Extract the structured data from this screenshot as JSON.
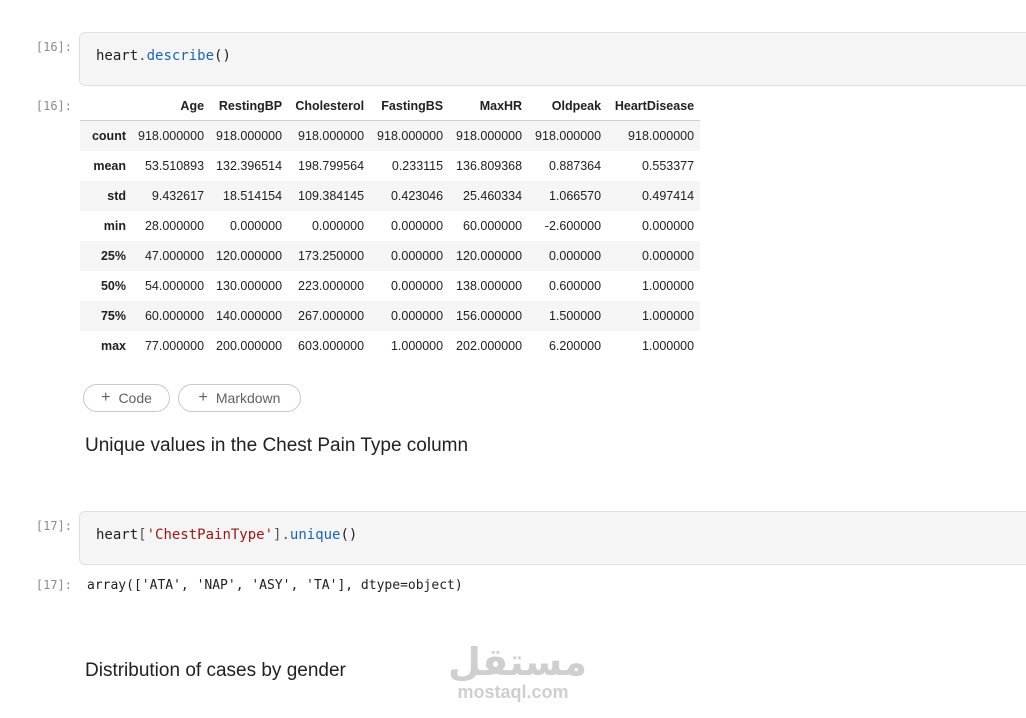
{
  "cells": {
    "describe": {
      "in_prompt": "[16]:",
      "out_prompt": "[16]:",
      "code_obj": "heart",
      "code_dot": ".",
      "code_func": "describe",
      "code_paren": "()"
    },
    "unique": {
      "in_prompt": "[17]:",
      "out_prompt": "[17]:",
      "code_obj": "heart",
      "code_lbr": "[",
      "code_str": "'ChestPainType'",
      "code_rbr": "]",
      "code_dot": ".",
      "code_func": "unique",
      "code_paren": "()",
      "output": "array(['ATA', 'NAP', 'ASY', 'TA'], dtype=object)"
    }
  },
  "table": {
    "columns": [
      "",
      "Age",
      "RestingBP",
      "Cholesterol",
      "FastingBS",
      "MaxHR",
      "Oldpeak",
      "HeartDisease"
    ],
    "rows": [
      [
        "count",
        "918.000000",
        "918.000000",
        "918.000000",
        "918.000000",
        "918.000000",
        "918.000000",
        "918.000000"
      ],
      [
        "mean",
        "53.510893",
        "132.396514",
        "198.799564",
        "0.233115",
        "136.809368",
        "0.887364",
        "0.553377"
      ],
      [
        "std",
        "9.432617",
        "18.514154",
        "109.384145",
        "0.423046",
        "25.460334",
        "1.066570",
        "0.497414"
      ],
      [
        "min",
        "28.000000",
        "0.000000",
        "0.000000",
        "0.000000",
        "60.000000",
        "-2.600000",
        "0.000000"
      ],
      [
        "25%",
        "47.000000",
        "120.000000",
        "173.250000",
        "0.000000",
        "120.000000",
        "0.000000",
        "0.000000"
      ],
      [
        "50%",
        "54.000000",
        "130.000000",
        "223.000000",
        "0.000000",
        "138.000000",
        "0.600000",
        "1.000000"
      ],
      [
        "75%",
        "60.000000",
        "140.000000",
        "267.000000",
        "0.000000",
        "156.000000",
        "1.500000",
        "1.000000"
      ],
      [
        "max",
        "77.000000",
        "200.000000",
        "603.000000",
        "1.000000",
        "202.000000",
        "6.200000",
        "1.000000"
      ]
    ]
  },
  "toolbar": {
    "add_code_label": "Code",
    "add_markdown_label": "Markdown",
    "plus_icon": "plus-icon"
  },
  "markdown": {
    "chest_pain_heading": "Unique values in the Chest Pain Type column",
    "gender_heading": "Distribution of cases by gender"
  },
  "watermark": {
    "arabic": "مستقل",
    "latin": "mostaql.com"
  },
  "colors": {
    "function": "#1b64b6",
    "string": "#a31515",
    "cell_bg": "#f5f5f5"
  }
}
